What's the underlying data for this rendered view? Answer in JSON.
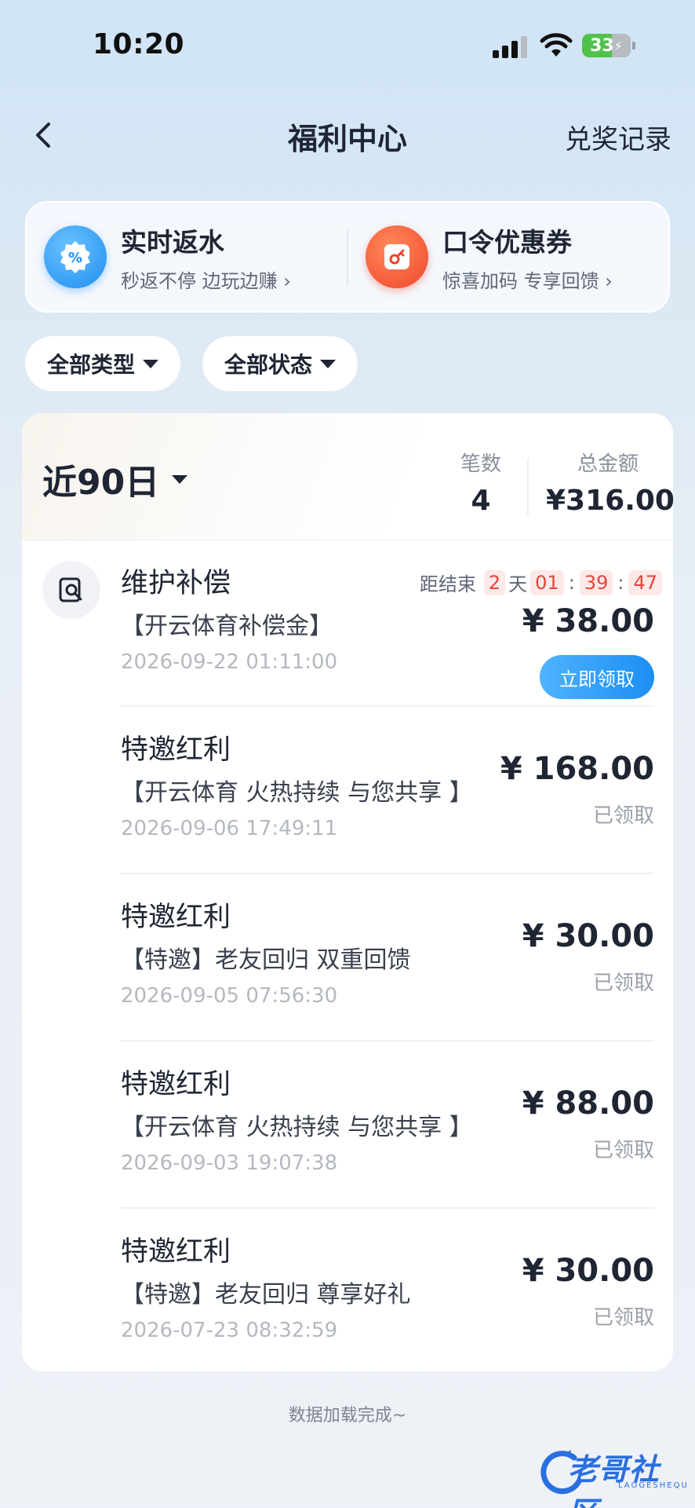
{
  "status_bar": {
    "time": "10:20",
    "battery": "33"
  },
  "nav": {
    "title": "福利中心",
    "action": "兑奖记录"
  },
  "promo": [
    {
      "title": "实时返水",
      "subtitle": "秒返不停 边玩边赚 ›"
    },
    {
      "title": "口令优惠券",
      "subtitle": "惊喜加码 专享回馈 ›"
    }
  ],
  "filters": {
    "type": "全部类型",
    "status": "全部状态"
  },
  "summary": {
    "period": "近90日",
    "count_label": "笔数",
    "count_value": "4",
    "total_label": "总金额",
    "total_value": "¥316.00"
  },
  "records": [
    {
      "title": "维护补偿",
      "desc": "【开云体育补偿金】",
      "date": "2026-09-22 01:11:00",
      "amount": "¥ 38.00",
      "countdown": {
        "label": "距结束",
        "days": "2",
        "day_unit": "天",
        "h": "01",
        "m": "39",
        "s": "47"
      },
      "action": "立即领取"
    },
    {
      "title": "特邀红利",
      "desc": "【开云体育 火热持续 与您共享 】",
      "date": "2026-09-06 17:49:11",
      "amount": "¥ 168.00",
      "status": "已领取"
    },
    {
      "title": "特邀红利",
      "desc": "【特邀】老友回归 双重回馈",
      "date": "2026-09-05 07:56:30",
      "amount": "¥ 30.00",
      "status": "已领取"
    },
    {
      "title": "特邀红利",
      "desc": "【开云体育 火热持续 与您共享 】",
      "date": "2026-09-03 19:07:38",
      "amount": "¥ 88.00",
      "status": "已领取"
    },
    {
      "title": "特邀红利",
      "desc": "【特邀】老友回归 尊享好礼",
      "date": "2026-07-23 08:32:59",
      "amount": "¥ 30.00",
      "status": "已领取"
    }
  ],
  "footer": "数据加载完成~",
  "watermark": {
    "text": "老哥社区",
    "sub": "LAOGESHEQU"
  }
}
